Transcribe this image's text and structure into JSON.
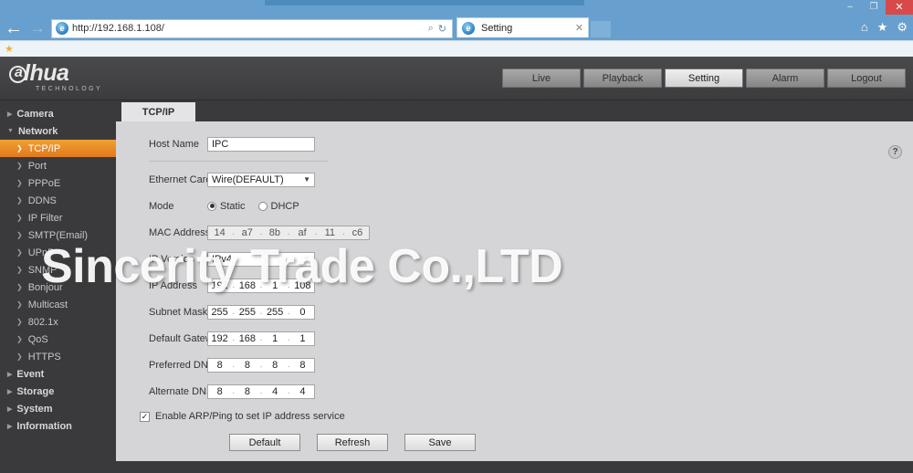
{
  "browser": {
    "url": "http://192.168.1.108/",
    "back_icon": "back-arrow-icon",
    "forward_icon": "forward-arrow-icon",
    "search_icon": "⌕",
    "refresh_icon": "↻",
    "tab_title": "Setting",
    "tab_close": "✕",
    "home_icon": "⌂",
    "favorites_icon": "★",
    "tools_icon": "⚙",
    "minimize": "–",
    "restore": "❐",
    "close": "✕",
    "fav_star": "★"
  },
  "logo": {
    "brand": "lhua",
    "ring_letter": "a",
    "subtitle": "TECHNOLOGY"
  },
  "topnav": [
    {
      "label": "Live",
      "active": false
    },
    {
      "label": "Playback",
      "active": false
    },
    {
      "label": "Setting",
      "active": true
    },
    {
      "label": "Alarm",
      "active": false
    },
    {
      "label": "Logout",
      "active": false
    }
  ],
  "sidebar": {
    "groups": [
      {
        "label": "Camera",
        "expanded": false,
        "items": []
      },
      {
        "label": "Network",
        "expanded": true,
        "items": [
          {
            "label": "TCP/IP",
            "selected": true
          },
          {
            "label": "Port",
            "selected": false
          },
          {
            "label": "PPPoE",
            "selected": false
          },
          {
            "label": "DDNS",
            "selected": false
          },
          {
            "label": "IP Filter",
            "selected": false
          },
          {
            "label": "SMTP(Email)",
            "selected": false
          },
          {
            "label": "UPnP",
            "selected": false
          },
          {
            "label": "SNMP",
            "selected": false
          },
          {
            "label": "Bonjour",
            "selected": false
          },
          {
            "label": "Multicast",
            "selected": false
          },
          {
            "label": "802.1x",
            "selected": false
          },
          {
            "label": "QoS",
            "selected": false
          },
          {
            "label": "HTTPS",
            "selected": false
          }
        ]
      },
      {
        "label": "Event",
        "expanded": false,
        "items": []
      },
      {
        "label": "Storage",
        "expanded": false,
        "items": []
      },
      {
        "label": "System",
        "expanded": false,
        "items": []
      },
      {
        "label": "Information",
        "expanded": false,
        "items": []
      }
    ]
  },
  "content": {
    "tab_label": "TCP/IP",
    "help_icon": "?",
    "fields": {
      "host_name": {
        "label": "Host Name",
        "value": "IPC"
      },
      "ethernet_card": {
        "label": "Ethernet Card",
        "value": "Wire(DEFAULT)"
      },
      "mode": {
        "label": "Mode",
        "static_label": "Static",
        "dhcp_label": "DHCP",
        "selected": "Static"
      },
      "mac_address": {
        "label": "MAC Address",
        "octets": [
          "14",
          "a7",
          "8b",
          "af",
          "11",
          "c6"
        ]
      },
      "ip_version": {
        "label": "IP Version",
        "value": "IPv4"
      },
      "ip_address": {
        "label": "IP Address",
        "octets": [
          "192",
          "168",
          "1",
          "108"
        ]
      },
      "subnet_mask": {
        "label": "Subnet Mask",
        "octets": [
          "255",
          "255",
          "255",
          "0"
        ]
      },
      "default_gateway": {
        "label": "Default Gateway",
        "octets": [
          "192",
          "168",
          "1",
          "1"
        ]
      },
      "preferred_dns": {
        "label": "Preferred DNS",
        "octets": [
          "8",
          "8",
          "8",
          "8"
        ]
      },
      "alternate_dns": {
        "label": "Alternate DNS",
        "octets": [
          "8",
          "8",
          "4",
          "4"
        ]
      }
    },
    "arp_checkbox": {
      "label": "Enable ARP/Ping to set IP address service",
      "checked": true,
      "mark": "✓"
    },
    "buttons": [
      {
        "label": "Default"
      },
      {
        "label": "Refresh"
      },
      {
        "label": "Save"
      }
    ]
  },
  "watermark": {
    "text": "Sincerity Trade Co.,LTD"
  },
  "colors": {
    "accent_orange": "#e2791c",
    "browser_blue": "#67a0ce",
    "panel_dark": "#3a3a3c",
    "content_gray": "#d5d5d7"
  }
}
